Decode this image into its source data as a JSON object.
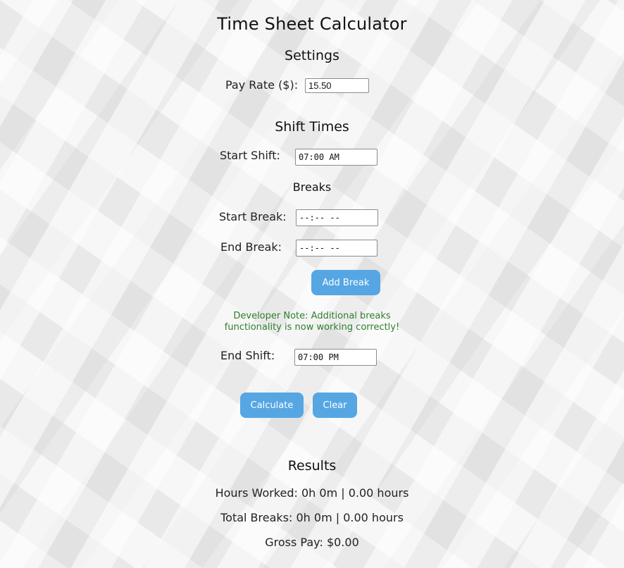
{
  "title": "Time Sheet Calculator",
  "settings": {
    "heading": "Settings",
    "pay_rate_label": "Pay Rate ($):",
    "pay_rate_value": "15.50"
  },
  "shift": {
    "heading": "Shift Times",
    "start_label": "Start Shift:",
    "start_value": "07:00 AM",
    "end_label": "End Shift:",
    "end_value": "07:00 PM"
  },
  "breaks": {
    "heading": "Breaks",
    "start_label": "Start Break:",
    "start_value": "--:-- --",
    "end_label": "End Break:",
    "end_value": "--:-- --",
    "add_button": "Add Break",
    "note_line1": "Developer Note: Additional breaks",
    "note_line2": "functionality is now working correctly!"
  },
  "actions": {
    "calculate": "Calculate",
    "clear": "Clear"
  },
  "results": {
    "heading": "Results",
    "hours_worked": "Hours Worked: 0h 0m | 0.00 hours",
    "total_breaks": "Total Breaks: 0h 0m | 0.00 hours",
    "gross_pay": "Gross Pay: $0.00"
  },
  "colors": {
    "button": "#56a6e3",
    "note": "#2e7d2e"
  }
}
